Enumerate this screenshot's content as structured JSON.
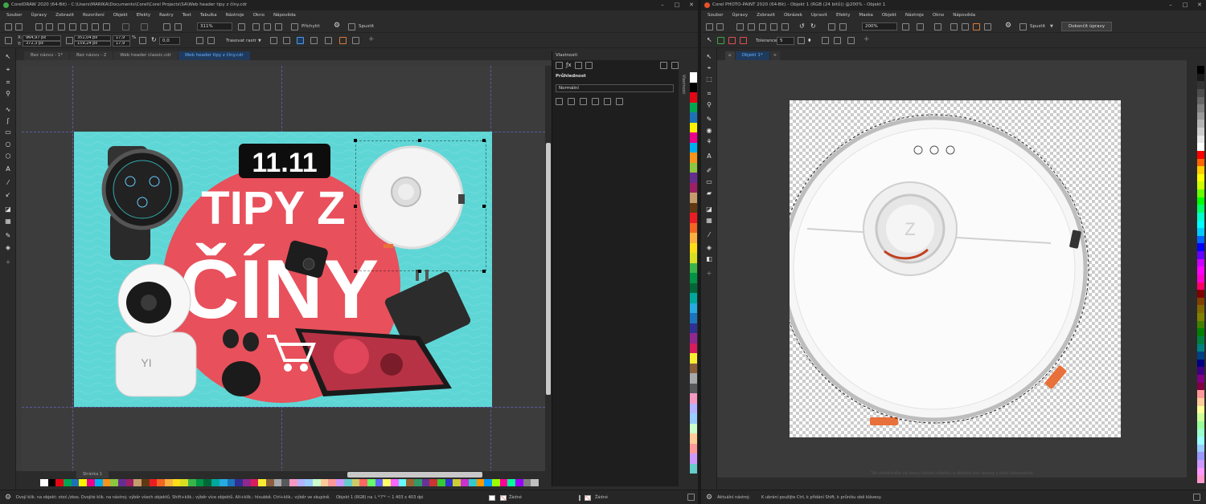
{
  "coreldraw": {
    "title": "CorelDRAW 2020 (64-Bit) - C:\\Users\\MARIKA\\Documents\\Corel\\Corel Projects\\SA\\Web header tipy z číny.cdr",
    "menu": [
      "Soubor",
      "Úpravy",
      "Zobrazit",
      "Rozvržení",
      "Objekt",
      "Efekty",
      "Rastry",
      "Text",
      "Tabulka",
      "Nástroje",
      "Okno",
      "Nápověda"
    ],
    "zoom": "311%",
    "snap_label": "Přichytit",
    "launch_label": "Spustit",
    "coords": {
      "x": "964,97 px",
      "y": "372,3 px",
      "w": "351,04 px",
      "h": "159,24 px",
      "sx": "17,9",
      "sy": "17,9",
      "angle": "0,0"
    },
    "trace_label": "Trasovat rastr",
    "doc_tabs": [
      {
        "label": "Bez názvu - 1*",
        "active": false
      },
      {
        "label": "Bez názvu - 2",
        "active": false
      },
      {
        "label": "Web header classic.cdr",
        "active": false
      },
      {
        "label": "Web header tipy z číny.cdr",
        "active": true
      }
    ],
    "artwork": {
      "date_text": "11.11",
      "headline_1": "TIPY Z",
      "headline_2": "ČÍNY",
      "camera_brand": "YI",
      "bg_color": "#5fd6d6",
      "circle_color": "#e8505b"
    },
    "page_tab": "Stránka 1",
    "properties_panel": {
      "title": "Vlastnosti",
      "section": "Průhlednost",
      "mode": "Normální",
      "side_label": "Vlastnosti"
    },
    "status": {
      "hint": "Dvojí klik. na objekt: otoč./zkos. Dvojité klik. na nástroj: výběr všech objektů. Shift+klik.: výběr více objektů. Alt+klik.: hloubkě. Ctrl+klik.: výběr ve skupině.",
      "object_info": "Objekt 1 (RGB) na Ｌ*ア* ~ 1 403 x 403 dpi",
      "fill": "Žádné",
      "outline": "Žádné"
    },
    "palette": [
      "#ffffff",
      "#000000",
      "#e30613",
      "#00a651",
      "#1d71b8",
      "#fff200",
      "#ec008c",
      "#00aeef",
      "#f7941d",
      "#8dc63f",
      "#662d91",
      "#9e1f63",
      "#c69c6d",
      "#603913",
      "#ed1c24",
      "#f26522",
      "#fbb040",
      "#ffde17",
      "#d7df23",
      "#39b54a",
      "#009444",
      "#006838",
      "#00a79d",
      "#27aae1",
      "#1c75bc",
      "#2e3192",
      "#92278f",
      "#da1c5c",
      "#f9ed32",
      "#8b5e3c",
      "#a7a9ac",
      "#58595b",
      "#f49ac2",
      "#b3b3ff",
      "#99ccff",
      "#ccffcc",
      "#ffcc99",
      "#ff9999",
      "#cc99ff",
      "#66cccc",
      "#cccc66",
      "#ff6666",
      "#66ff66",
      "#6666ff",
      "#ffff66",
      "#ff66ff",
      "#66ffff",
      "#996633",
      "#339966",
      "#663399",
      "#cc3333",
      "#33cc33",
      "#3333cc",
      "#cccc33",
      "#cc33cc",
      "#33cccc",
      "#ff9900",
      "#0099ff",
      "#99ff00",
      "#ff0099",
      "#00ff99",
      "#9900ff",
      "#808080",
      "#c0c0c0"
    ]
  },
  "photopaint": {
    "title": "Corel PHOTO-PAINT 2020 (64-Bit) - Objekt 1 (RGB (24 bitů)) @200% - Objekt 1",
    "menu": [
      "Soubor",
      "Úpravy",
      "Zobrazit",
      "Obrázek",
      "Upravit",
      "Efekty",
      "Maska",
      "Objekt",
      "Nástroje",
      "Okno",
      "Nápověda"
    ],
    "zoom": "200%",
    "launch_label": "Spustit",
    "finish_label": "Dokončit úpravy",
    "tolerance_label": "Tolerance:",
    "tolerance_value": "5",
    "doc_tab": "Objekt 1*",
    "hint_center": "Tah přetáhněte na hranu tohoto objektu a oblaste bez úpravy z okolí dokumentu",
    "status": {
      "tool": "Aktuální nástroj:",
      "hint": "K ubrání použijte Ctrl, k přidání Shift, k průniku obě klávesy."
    },
    "palette": [
      "#000000",
      "#1a1a1a",
      "#333333",
      "#4d4d4d",
      "#666666",
      "#808080",
      "#999999",
      "#b3b3b3",
      "#cccccc",
      "#e6e6e6",
      "#ffffff",
      "#ff0000",
      "#ff6600",
      "#ffcc00",
      "#ffff00",
      "#ccff00",
      "#66ff00",
      "#00ff00",
      "#00ff66",
      "#00ffcc",
      "#00ffff",
      "#00ccff",
      "#0066ff",
      "#0000ff",
      "#6600ff",
      "#cc00ff",
      "#ff00ff",
      "#ff00cc",
      "#ff0066",
      "#800000",
      "#804000",
      "#806600",
      "#808000",
      "#408000",
      "#008000",
      "#008040",
      "#008080",
      "#004080",
      "#000080",
      "#400080",
      "#800080",
      "#800040",
      "#ff9999",
      "#ffcc99",
      "#ffff99",
      "#ccff99",
      "#99ff99",
      "#99ffcc",
      "#99ffff",
      "#99ccff",
      "#9999ff",
      "#cc99ff",
      "#ff99ff",
      "#ff99cc"
    ]
  }
}
